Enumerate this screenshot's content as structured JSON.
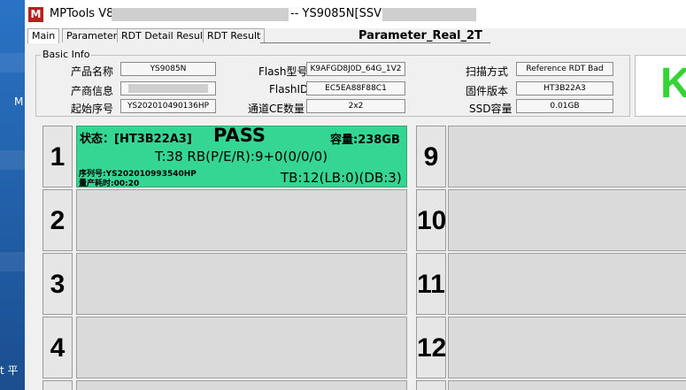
{
  "window": {
    "title_prefix": "MPTools V8",
    "title_mid": "-- YS9085N[SSV7",
    "app_icon": "M"
  },
  "tabs": [
    {
      "label": "Main"
    },
    {
      "label": "Parameter"
    },
    {
      "label": "RDT Detail Result"
    },
    {
      "label": "RDT Result"
    }
  ],
  "parameter_title": "Parameter_Real_2T",
  "basic_info": {
    "title": "Basic Info",
    "product_label": "产品名称",
    "product_value": "YS9085N",
    "vendor_label": "产商信息",
    "vendor_value": "",
    "start_sn_label": "起始序号",
    "start_sn_value": "YS202010490136HP",
    "flash_type_label": "Flash型号",
    "flash_type_value": "K9AFGD8J0D_64G_1V2",
    "flash_id_label": "FlashID",
    "flash_id_value": "EC5EA88F88C1",
    "ce_label": "通道CE数量",
    "ce_value": "2x2",
    "scan_label": "扫描方式",
    "scan_value": "Reference RDT Bad",
    "fw_label": "固件版本",
    "fw_value": "HT3B22A3",
    "ssd_label": "SSD容量",
    "ssd_value": "0.01GB"
  },
  "big_status_letter": "K",
  "ports": {
    "p1": {
      "number": "1",
      "status": "状态：[HT3B22A3]",
      "result": "PASS",
      "capacity": "容量:238GB",
      "stats": "T:38 RB(P/E/R):9+0(0/0/0)",
      "serial": "序列号:YS202010993540HP",
      "time": "量产耗时:00:20",
      "tb": "TB:12(LB:0)(DB:3)"
    },
    "p2": {
      "number": "2"
    },
    "p3": {
      "number": "3"
    },
    "p4": {
      "number": "4"
    },
    "p9": {
      "number": "9"
    },
    "p10": {
      "number": "10"
    },
    "p11": {
      "number": "11"
    },
    "p12": {
      "number": "12"
    }
  },
  "desktop": {
    "side_m": "M",
    "side_bottom": "t 平"
  }
}
